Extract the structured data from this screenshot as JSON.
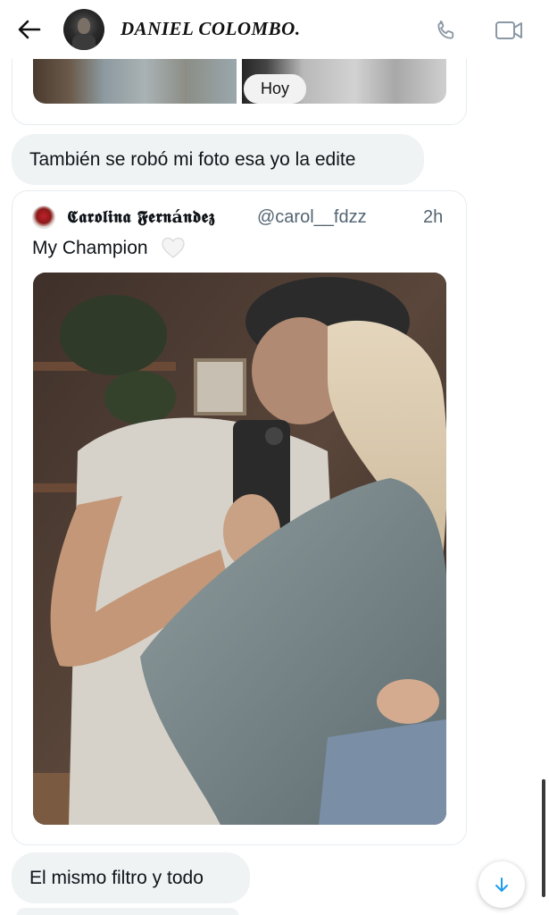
{
  "header": {
    "back_icon": "arrow-left-icon",
    "contact_name": "DANIEL COLOMBO.",
    "call_icon": "phone-icon",
    "video_icon": "video-camera-icon"
  },
  "previous_message": {
    "date_pill": "Hoy"
  },
  "messages": [
    {
      "text": "También se robó mi foto esa yo la edite"
    },
    {
      "text": "El mismo filtro y todo"
    }
  ],
  "tweet": {
    "author_display_name": "𝕮𝖆𝖗𝖔𝖑𝖎𝖓𝖆 𝕱𝖊𝖗𝖓á𝖓𝖉𝖊𝖟",
    "handle": "@carol__fdzz",
    "time": "2h",
    "text": "My Champion",
    "emoji": "white-heart-icon"
  },
  "colors": {
    "bubble_bg": "#eff3f4",
    "muted_text": "#536471",
    "accent": "#1d9bf0"
  }
}
